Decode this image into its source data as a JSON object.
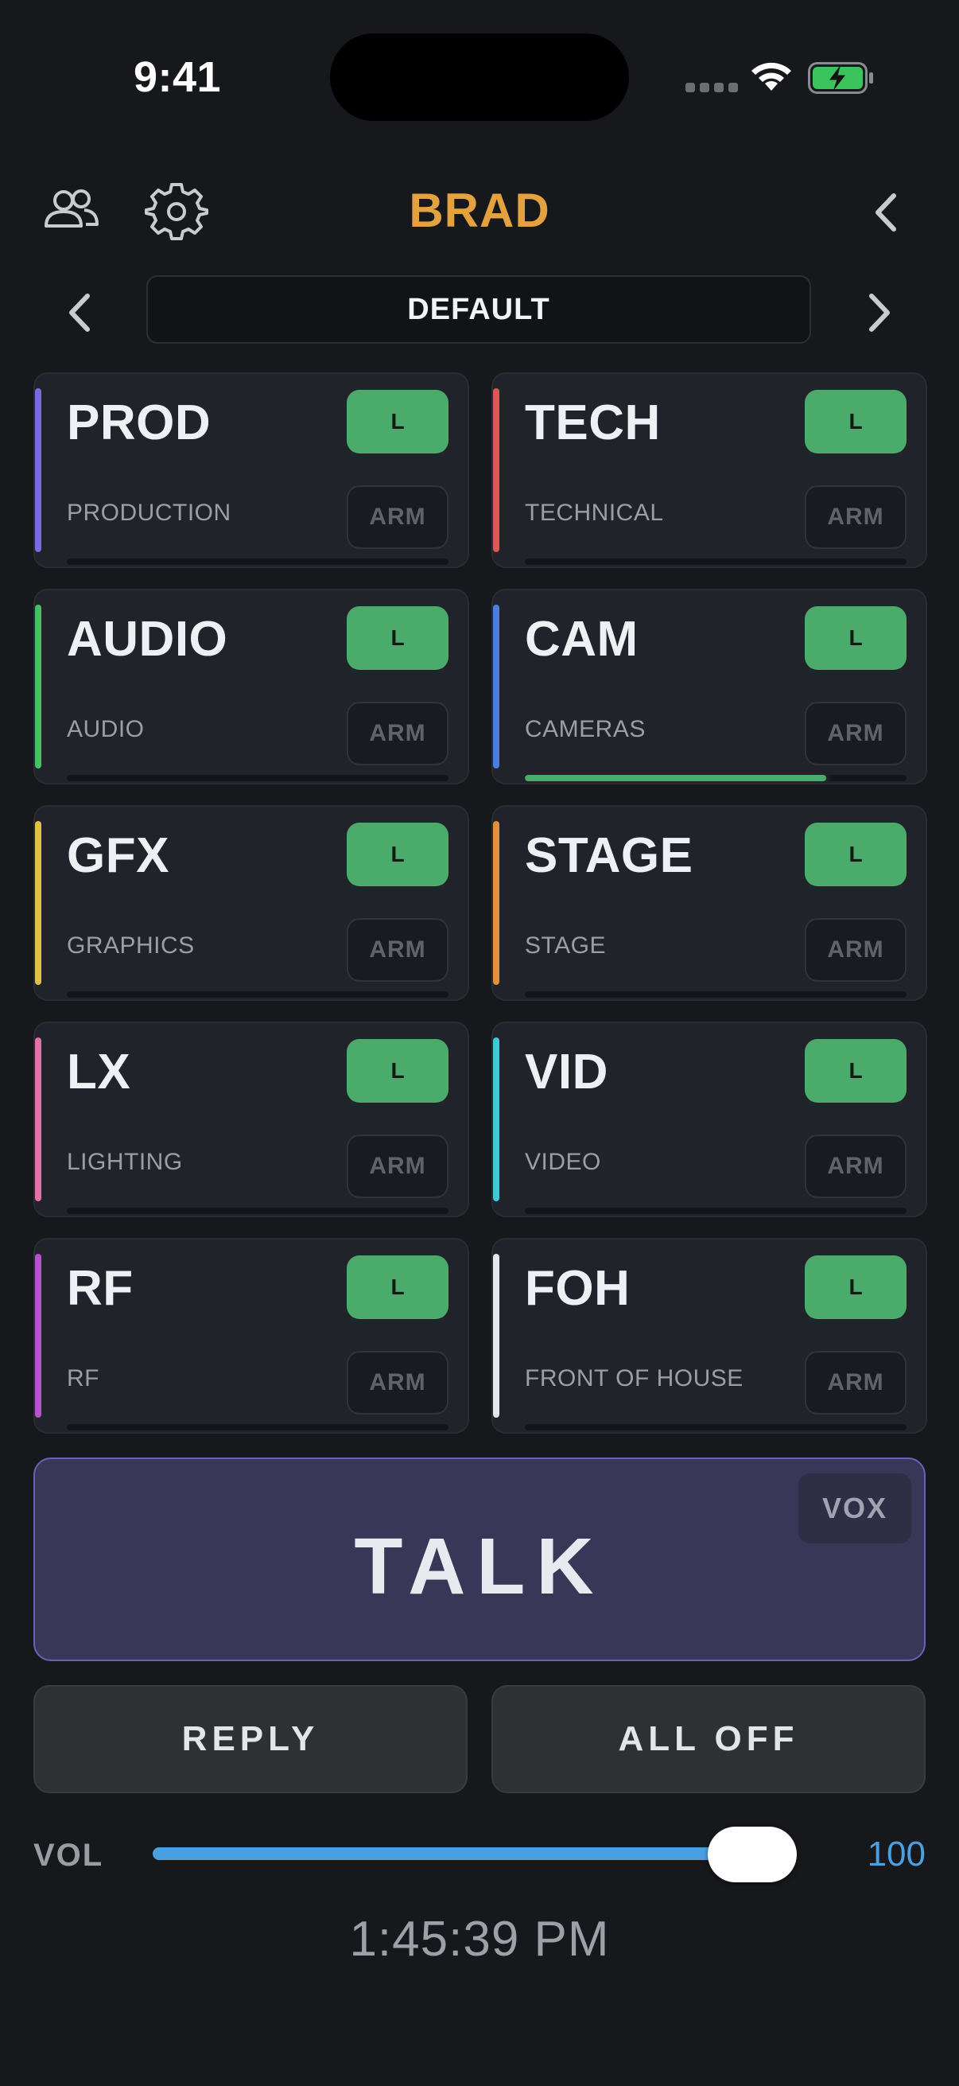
{
  "status_bar": {
    "time": "9:41"
  },
  "header": {
    "title": "BRAD"
  },
  "preset": {
    "name": "DEFAULT"
  },
  "channels": [
    {
      "code": "PROD",
      "desc": "PRODUCTION",
      "listen_label": "L",
      "arm_label": "ARM",
      "color": "#7b6be0",
      "level": 0
    },
    {
      "code": "TECH",
      "desc": "TECHNICAL",
      "listen_label": "L",
      "arm_label": "ARM",
      "color": "#e05555",
      "level": 0
    },
    {
      "code": "AUDIO",
      "desc": "AUDIO",
      "listen_label": "L",
      "arm_label": "ARM",
      "color": "#45c065",
      "level": 0
    },
    {
      "code": "CAM",
      "desc": "CAMERAS",
      "listen_label": "L",
      "arm_label": "ARM",
      "color": "#4a7ee0",
      "level": 0.79
    },
    {
      "code": "GFX",
      "desc": "GRAPHICS",
      "listen_label": "L",
      "arm_label": "ARM",
      "color": "#e0c245",
      "level": 0
    },
    {
      "code": "STAGE",
      "desc": "STAGE",
      "listen_label": "L",
      "arm_label": "ARM",
      "color": "#e0903a",
      "level": 0
    },
    {
      "code": "LX",
      "desc": "LIGHTING",
      "listen_label": "L",
      "arm_label": "ARM",
      "color": "#e56fa8",
      "level": 0
    },
    {
      "code": "VID",
      "desc": "VIDEO",
      "listen_label": "L",
      "arm_label": "ARM",
      "color": "#3ec9d6",
      "level": 0
    },
    {
      "code": "RF",
      "desc": "RF",
      "listen_label": "L",
      "arm_label": "ARM",
      "color": "#b552cc",
      "level": 0
    },
    {
      "code": "FOH",
      "desc": "FRONT OF HOUSE",
      "listen_label": "L",
      "arm_label": "ARM",
      "color": "#e8e8ea",
      "level": 0
    }
  ],
  "talk": {
    "label": "TALK",
    "vox_label": "VOX"
  },
  "actions": {
    "reply_label": "REPLY",
    "all_off_label": "ALL OFF"
  },
  "volume": {
    "label": "VOL",
    "value": 100,
    "value_text": "100",
    "max": 100
  },
  "clock": {
    "time": "1:45:39 PM"
  },
  "colors": {
    "accent": "#e3a23f",
    "listen_green": "#4aab6b",
    "volume_blue": "#4a9fe0",
    "talk_purple": "#393758"
  }
}
